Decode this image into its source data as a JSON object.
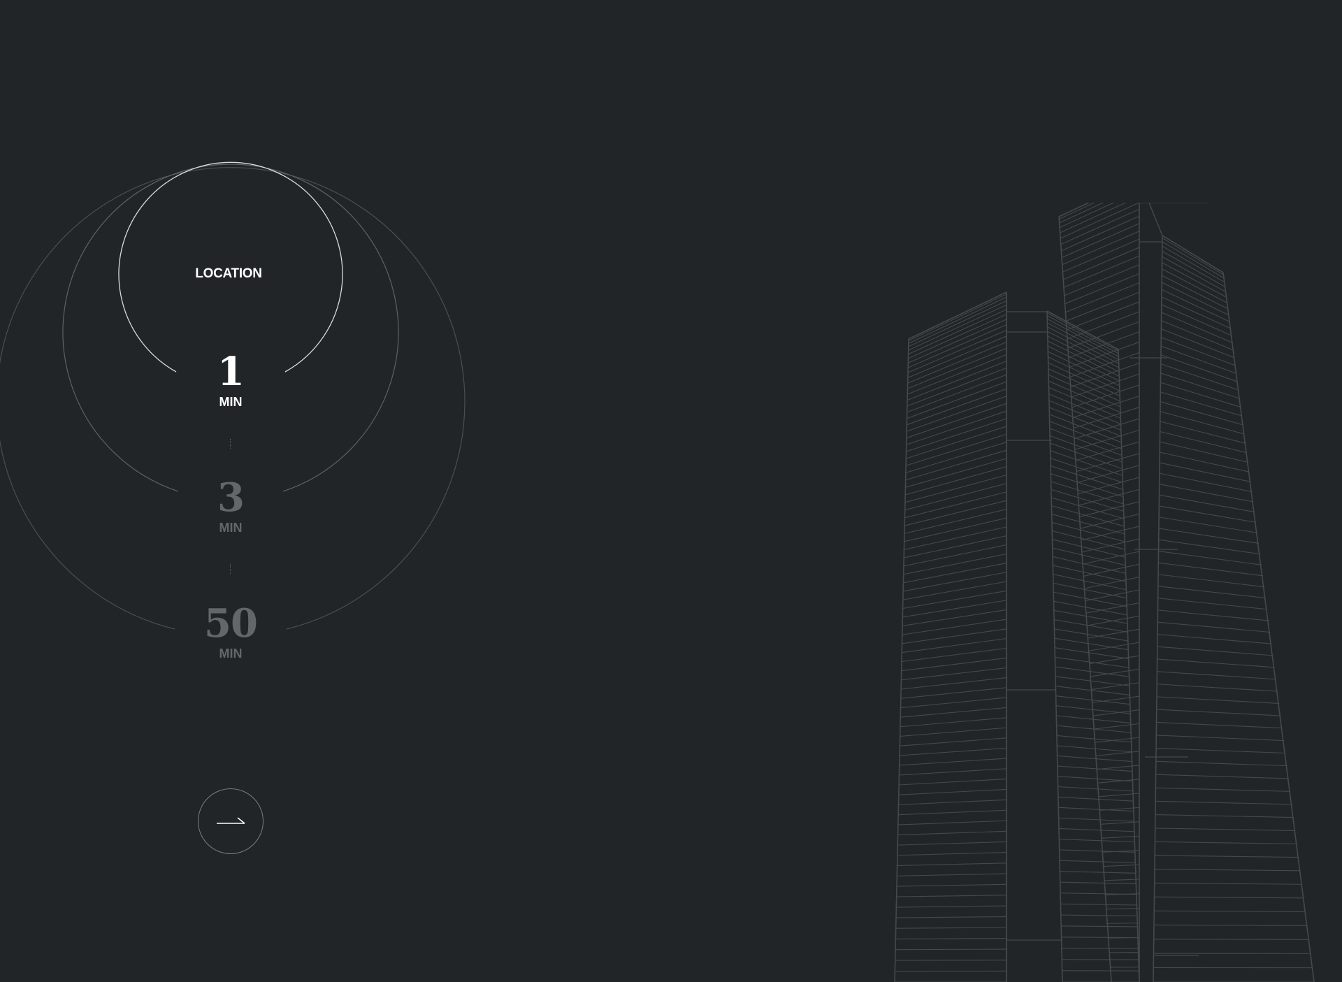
{
  "location": {
    "label": "LOCATION"
  },
  "travel_times": [
    {
      "value": "1",
      "unit": "MIN",
      "state": "active"
    },
    {
      "value": "3",
      "unit": "MIN",
      "state": "muted"
    },
    {
      "value": "50",
      "unit": "MIN",
      "state": "muted"
    }
  ],
  "next_button": {
    "icon": "arrow-right-icon"
  },
  "colors": {
    "background": "#212528",
    "active_text": "#ffffff",
    "muted_text": "#63676a",
    "ring_inner": "#d9dadb",
    "ring_outer": "#55595c",
    "tower_lines": "#45494c"
  }
}
